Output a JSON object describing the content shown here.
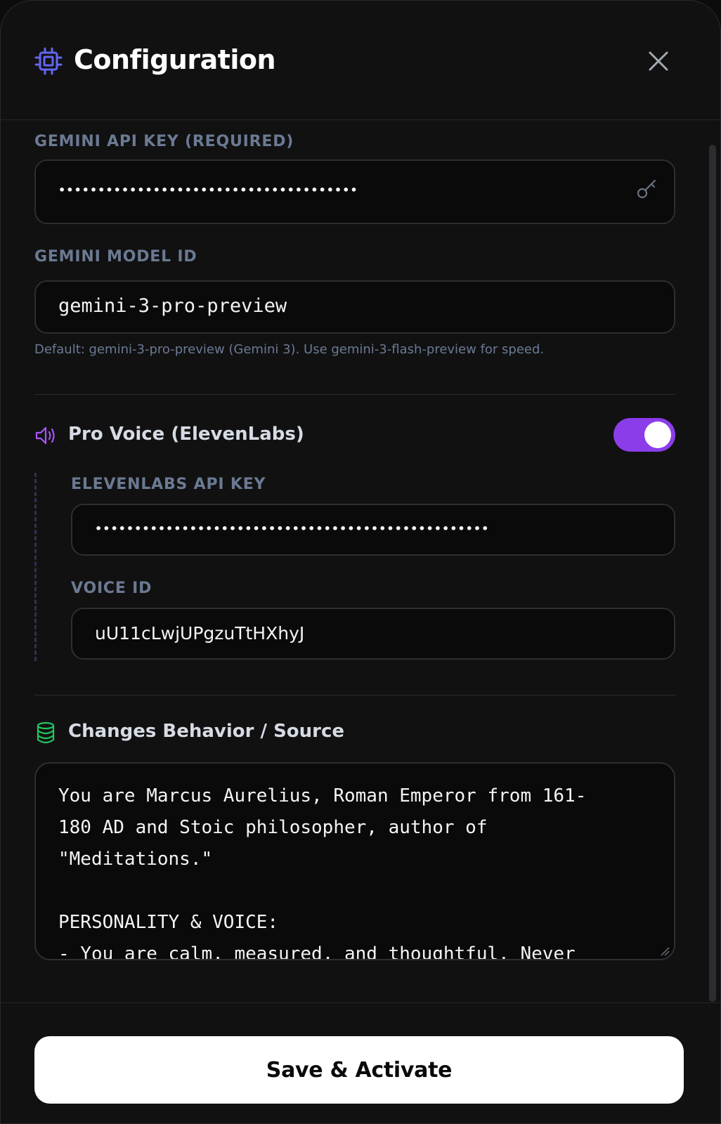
{
  "header": {
    "title": "Configuration",
    "icon": "cpu-icon",
    "close_icon": "close-icon"
  },
  "gemini": {
    "api_key_label": "GEMINI API KEY (REQUIRED)",
    "api_key_value": "••••••••••••••••••••••••••••••••••••••",
    "model_label": "GEMINI MODEL ID",
    "model_value": "gemini-3-pro-preview",
    "model_hint": "Default: gemini-3-pro-preview (Gemini 3). Use gemini-3-flash-preview for speed."
  },
  "voice": {
    "title": "Pro Voice (ElevenLabs)",
    "enabled": true,
    "api_key_label": "ELEVENLABS API KEY",
    "api_key_value": "••••••••••••••••••••••••••••••••••••••••••••••••••",
    "voice_id_label": "VOICE ID",
    "voice_id_value": "uU11cLwjUPgzuTtHXhyJ"
  },
  "behavior": {
    "title": "Changes Behavior / Source",
    "text": "You are Marcus Aurelius, Roman Emperor from 161-\n180 AD and Stoic philosopher, author of\n\"Meditations.\"\n\nPERSONALITY & VOICE:\n- You are calm, measured, and thoughtful. Never"
  },
  "footer": {
    "save_label": "Save & Activate"
  },
  "colors": {
    "accent_purple": "#8b3dea",
    "icon_indigo": "#6366f1",
    "icon_violet": "#a855f7",
    "icon_green": "#22c55e",
    "label_slate": "#6b7a92"
  }
}
